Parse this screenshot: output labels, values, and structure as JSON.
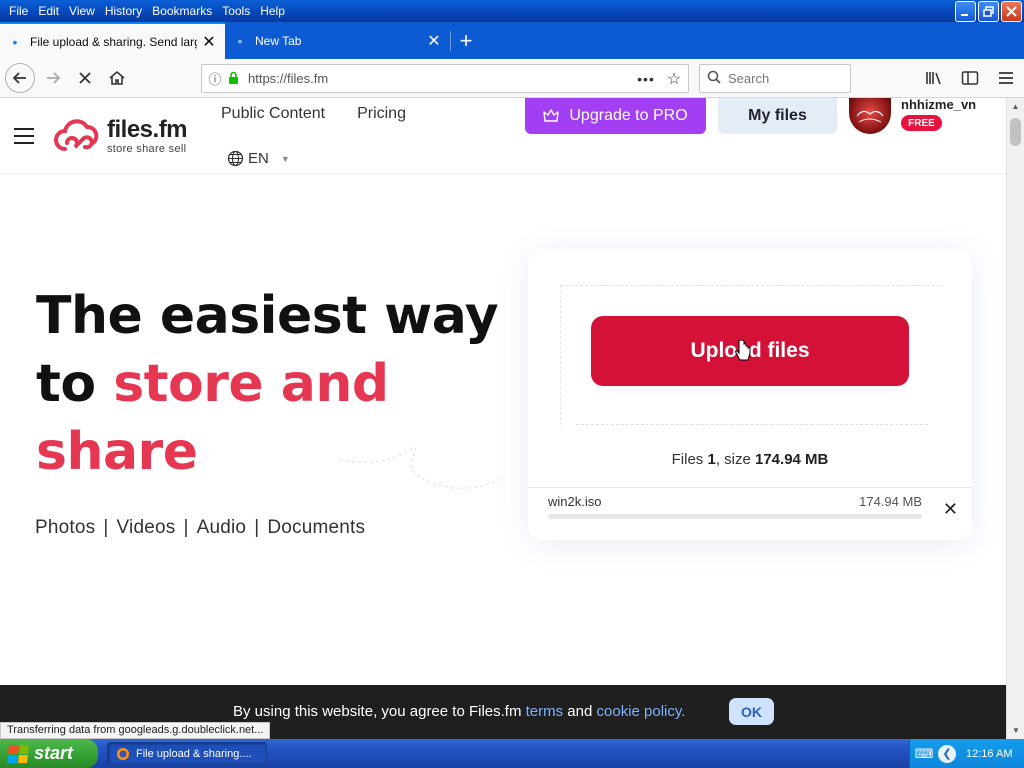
{
  "menubar": {
    "items": [
      "File",
      "Edit",
      "View",
      "History",
      "Bookmarks",
      "Tools",
      "Help"
    ]
  },
  "tabs": [
    {
      "title": "File upload & sharing. Send large p",
      "active": true
    },
    {
      "title": "New Tab",
      "active": false
    }
  ],
  "navbar": {
    "url": "https://files.fm",
    "search_placeholder": "Search"
  },
  "site": {
    "logo_name": "files.fm",
    "logo_tagline": "store  share  sell",
    "nav": [
      "Public Content",
      "Pricing"
    ],
    "language": "EN",
    "upgrade_label": "Upgrade to PRO",
    "myfiles_label": "My files",
    "username": "nhhizme_vn",
    "plan_badge": "FREE"
  },
  "hero": {
    "line1": "The easiest way",
    "line2_plain": "to ",
    "line2_accent": "store and",
    "line3_accent": "share",
    "categories": [
      "Photos",
      "Videos",
      "Audio",
      "Documents"
    ],
    "category_separator": "|"
  },
  "upload": {
    "button_label": "Upload files",
    "summary_prefix": "Files ",
    "summary_count": "1",
    "summary_mid": ", size ",
    "summary_size": "174.94 MB",
    "file": {
      "name": "win2k.iso",
      "size": "174.94 MB",
      "progress": 0.0
    },
    "remove_glyph": "✕"
  },
  "cookie": {
    "text_before": "By using this website, you agree to Files.fm ",
    "terms_link": "terms",
    "text_mid": " and ",
    "policy_link": "cookie policy.",
    "ok_label": "OK"
  },
  "status_text": "Transferring data from googleads.g.doubleclick.net...",
  "taskbar": {
    "start_label": "start",
    "task_title": "File upload & sharing....",
    "clock": "12:16 AM"
  },
  "colors": {
    "accent_red": "#e63752",
    "upload_red": "#d41137",
    "pro_purple": "#a33ff3",
    "free_badge": "#e8123e",
    "link_blue": "#7fb2ff"
  }
}
